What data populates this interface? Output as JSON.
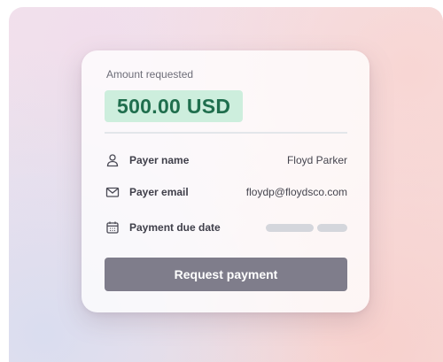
{
  "payment_request": {
    "amount_caption": "Amount requested",
    "amount": "500.00 USD",
    "fields": {
      "payer_name": {
        "label": "Payer name",
        "value": "Floyd Parker",
        "icon": "user-icon"
      },
      "payer_email": {
        "label": "Payer email",
        "value": "floydp@floydsco.com",
        "icon": "mail-icon"
      },
      "due_date": {
        "label": "Payment due date",
        "value_state": "loading-placeholder",
        "icon": "calendar-icon"
      }
    },
    "button_label": "Request payment"
  },
  "colors": {
    "amount_background": "#cdeedd",
    "amount_text": "#1f6e4d",
    "button_background": "#7f7d8b",
    "skeleton": "#d4d6dc"
  }
}
